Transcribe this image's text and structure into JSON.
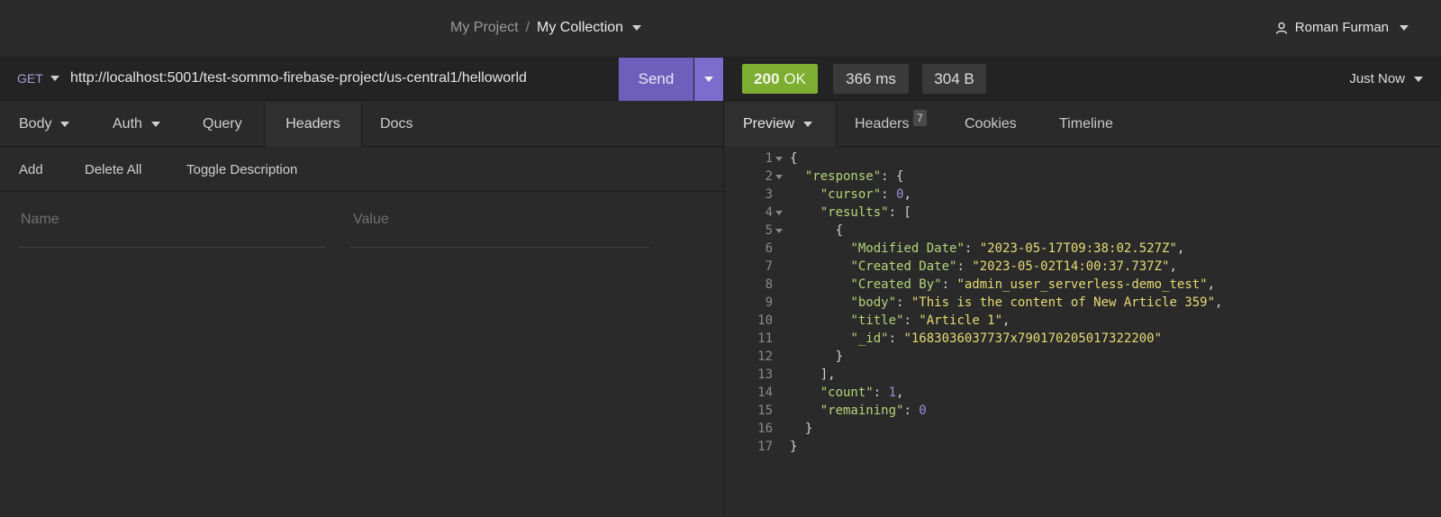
{
  "header": {
    "project": "My Project",
    "separator": "/",
    "collection": "My Collection",
    "user": "Roman Furman"
  },
  "request": {
    "method": "GET",
    "url": "http://localhost:5001/test-sommo-firebase-project/us-central1/helloworld",
    "send_label": "Send"
  },
  "request_tabs": {
    "body": "Body",
    "auth": "Auth",
    "query": "Query",
    "headers": "Headers",
    "docs": "Docs"
  },
  "header_actions": {
    "add": "Add",
    "delete_all": "Delete All",
    "toggle_description": "Toggle Description"
  },
  "header_row": {
    "name_placeholder": "Name",
    "value_placeholder": "Value"
  },
  "response": {
    "status_code": "200",
    "status_text": "OK",
    "time": "366 ms",
    "size": "304 B",
    "timestamp": "Just Now",
    "status_color": "#7dae32"
  },
  "response_tabs": {
    "preview": "Preview",
    "headers": "Headers",
    "headers_count": "7",
    "cookies": "Cookies",
    "timeline": "Timeline"
  },
  "response_body": {
    "lines": [
      {
        "no": "1",
        "fold": true,
        "indent": "",
        "parts": [
          [
            "p",
            "{"
          ]
        ]
      },
      {
        "no": "2",
        "fold": true,
        "indent": "  ",
        "parts": [
          [
            "k",
            "\"response\""
          ],
          [
            "p",
            ": {"
          ]
        ]
      },
      {
        "no": "3",
        "fold": false,
        "indent": "    ",
        "parts": [
          [
            "k",
            "\"cursor\""
          ],
          [
            "p",
            ": "
          ],
          [
            "n",
            "0"
          ],
          [
            "p",
            ","
          ]
        ]
      },
      {
        "no": "4",
        "fold": true,
        "indent": "    ",
        "parts": [
          [
            "k",
            "\"results\""
          ],
          [
            "p",
            ": ["
          ]
        ]
      },
      {
        "no": "5",
        "fold": true,
        "indent": "      ",
        "parts": [
          [
            "p",
            "{"
          ]
        ]
      },
      {
        "no": "6",
        "fold": false,
        "indent": "        ",
        "parts": [
          [
            "k",
            "\"Modified Date\""
          ],
          [
            "p",
            ": "
          ],
          [
            "s",
            "\"2023-05-17T09:38:02.527Z\""
          ],
          [
            "p",
            ","
          ]
        ]
      },
      {
        "no": "7",
        "fold": false,
        "indent": "        ",
        "parts": [
          [
            "k",
            "\"Created Date\""
          ],
          [
            "p",
            ": "
          ],
          [
            "s",
            "\"2023-05-02T14:00:37.737Z\""
          ],
          [
            "p",
            ","
          ]
        ]
      },
      {
        "no": "8",
        "fold": false,
        "indent": "        ",
        "parts": [
          [
            "k",
            "\"Created By\""
          ],
          [
            "p",
            ": "
          ],
          [
            "s",
            "\"admin_user_serverless-demo_test\""
          ],
          [
            "p",
            ","
          ]
        ]
      },
      {
        "no": "9",
        "fold": false,
        "indent": "        ",
        "parts": [
          [
            "k",
            "\"body\""
          ],
          [
            "p",
            ": "
          ],
          [
            "s",
            "\"This is the content of New Article 359\""
          ],
          [
            "p",
            ","
          ]
        ]
      },
      {
        "no": "10",
        "fold": false,
        "indent": "        ",
        "parts": [
          [
            "k",
            "\"title\""
          ],
          [
            "p",
            ": "
          ],
          [
            "s",
            "\"Article 1\""
          ],
          [
            "p",
            ","
          ]
        ]
      },
      {
        "no": "11",
        "fold": false,
        "indent": "        ",
        "parts": [
          [
            "k",
            "\"_id\""
          ],
          [
            "p",
            ": "
          ],
          [
            "s",
            "\"1683036037737x790170205017322200\""
          ]
        ]
      },
      {
        "no": "12",
        "fold": false,
        "indent": "      ",
        "parts": [
          [
            "p",
            "}"
          ]
        ]
      },
      {
        "no": "13",
        "fold": false,
        "indent": "    ",
        "parts": [
          [
            "p",
            "],"
          ]
        ]
      },
      {
        "no": "14",
        "fold": false,
        "indent": "    ",
        "parts": [
          [
            "k",
            "\"count\""
          ],
          [
            "p",
            ": "
          ],
          [
            "n",
            "1"
          ],
          [
            "p",
            ","
          ]
        ]
      },
      {
        "no": "15",
        "fold": false,
        "indent": "    ",
        "parts": [
          [
            "k",
            "\"remaining\""
          ],
          [
            "p",
            ": "
          ],
          [
            "n",
            "0"
          ]
        ]
      },
      {
        "no": "16",
        "fold": false,
        "indent": "  ",
        "parts": [
          [
            "p",
            "}"
          ]
        ]
      },
      {
        "no": "17",
        "fold": false,
        "indent": "",
        "parts": [
          [
            "p",
            "}"
          ]
        ]
      }
    ]
  }
}
